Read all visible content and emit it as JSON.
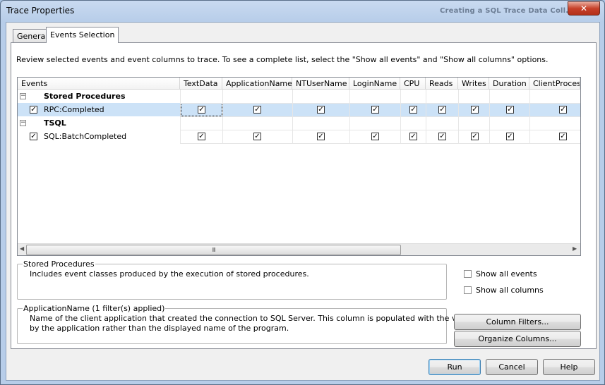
{
  "window": {
    "title": "Trace Properties",
    "background_title": "Creating a SQL Trace Data Coll...",
    "close_glyph": "✕"
  },
  "tabs": [
    {
      "label": "General",
      "active": false
    },
    {
      "label": "Events Selection",
      "active": true
    }
  ],
  "instructions": "Review selected events and event columns to trace. To see a complete list, select the \"Show all events\" and \"Show all columns\" options.",
  "grid": {
    "columns": [
      "Events",
      "TextData",
      "ApplicationName",
      "NTUserName",
      "LoginName",
      "CPU",
      "Reads",
      "Writes",
      "Duration",
      "ClientProcess"
    ],
    "groups": [
      {
        "name": "Stored Procedures",
        "expander": "−",
        "events": [
          {
            "name": "RPC:Completed",
            "checked": true,
            "selected": true,
            "cells": [
              true,
              true,
              true,
              true,
              true,
              true,
              true,
              true,
              true
            ]
          }
        ]
      },
      {
        "name": "TSQL",
        "expander": "−",
        "events": [
          {
            "name": "SQL:BatchCompleted",
            "checked": true,
            "selected": false,
            "cells": [
              true,
              true,
              true,
              true,
              true,
              true,
              true,
              true,
              true
            ]
          }
        ]
      }
    ],
    "check_glyph": "✓",
    "scroll": {
      "left_arrow": "◀",
      "right_arrow": "▶",
      "grip": "III"
    }
  },
  "event_info": {
    "title": "Stored Procedures",
    "description": "Includes event classes produced by the execution of stored procedures."
  },
  "column_info": {
    "title": "ApplicationName (1 filter(s) applied)",
    "line1": "Name of the client application that created the connection to SQL Server. This column is populated with the values passed",
    "line2": "by the application rather than the displayed name of the program."
  },
  "options": {
    "show_all_events": {
      "label": "Show all events",
      "checked": false
    },
    "show_all_columns": {
      "label": "Show all columns",
      "checked": false
    }
  },
  "buttons": {
    "column_filters": "Column Filters...",
    "organize_columns": "Organize Columns...",
    "run": "Run",
    "cancel": "Cancel",
    "help": "Help"
  }
}
